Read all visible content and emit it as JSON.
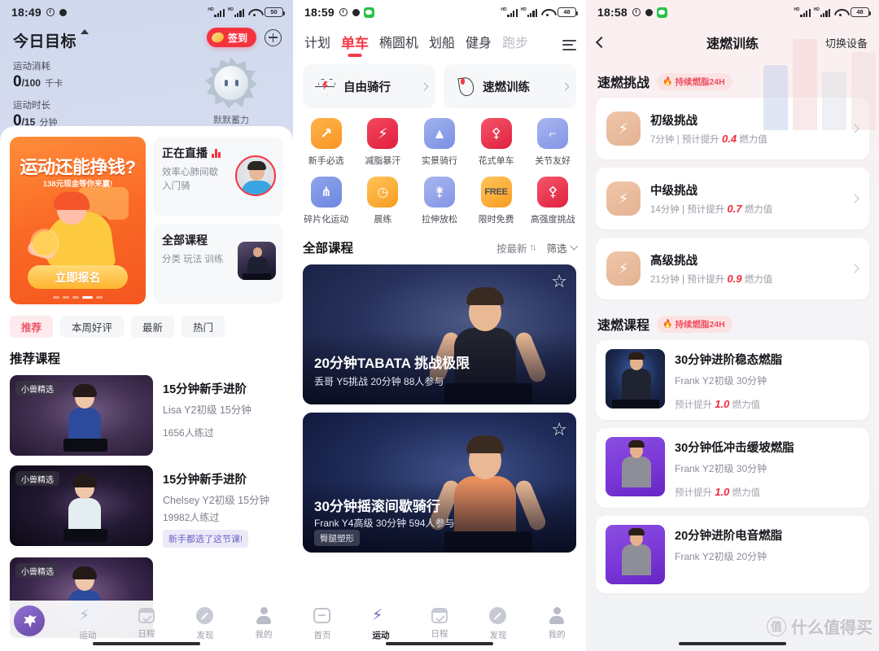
{
  "panel1": {
    "status": {
      "time": "18:49",
      "battery": "50",
      "icons": [
        "alarm-icon",
        "record-dot-icon",
        "signal-icon",
        "signal-icon",
        "wifi-icon",
        "battery-icon"
      ]
    },
    "header": {
      "title": "今日目标",
      "caret": "caret-up-icon",
      "stats": [
        {
          "label": "运动消耗",
          "value": "0",
          "unit": "/100",
          "suffix": "千卡"
        },
        {
          "label": "运动时长",
          "value": "0",
          "unit": "/15",
          "suffix": "分钟"
        }
      ],
      "signin_label": "签到",
      "add_label": "plus-icon",
      "mascot_label": "默默蓄力"
    },
    "promo": {
      "title": "运动还能挣钱?",
      "subtitle": "138元现金等你来赢!",
      "cta": "立即报名",
      "dots": 5,
      "active_dot": 3
    },
    "side_cards": [
      {
        "title": "正在直播",
        "live": true,
        "lines": "效率心肺间歇\n入门骑"
      },
      {
        "title": "全部课程",
        "live": false,
        "lines": "分类 玩法 训练"
      }
    ],
    "chips": [
      {
        "label": "推荐",
        "active": true
      },
      {
        "label": "本周好评",
        "active": false
      },
      {
        "label": "最新",
        "active": false
      },
      {
        "label": "热门",
        "active": false
      }
    ],
    "section_title": "推荐课程",
    "courses": [
      {
        "badge": "小兽精选",
        "title": "15分钟新手进阶",
        "sub": "Lisa Y2初级 15分钟",
        "count": "1656人练过",
        "tag": ""
      },
      {
        "badge": "小兽精选",
        "title": "15分钟新手进阶",
        "sub": "Chelsey Y2初级 15分钟",
        "count": "19982人练过",
        "tag": "新手都选了这节课!"
      },
      {
        "badge": "小兽精选",
        "title": "",
        "sub": "",
        "count": "",
        "tag": ""
      }
    ],
    "tabbar": [
      {
        "label": "",
        "icon": "unicorn-logo-icon",
        "active": true
      },
      {
        "label": "运动",
        "icon": "bolt-icon",
        "active": false
      },
      {
        "label": "日程",
        "icon": "calendar-check-icon",
        "active": false
      },
      {
        "label": "发现",
        "icon": "compass-icon",
        "active": false
      },
      {
        "label": "我的",
        "icon": "user-icon",
        "active": false
      }
    ]
  },
  "panel2": {
    "status": {
      "time": "18:59",
      "battery": "48",
      "icons": [
        "alarm-icon",
        "record-dot-icon",
        "wechat-icon",
        "signal-icon",
        "signal-icon",
        "wifi-icon",
        "battery-icon"
      ]
    },
    "tabs": [
      {
        "label": "计划",
        "active": false,
        "dim": false
      },
      {
        "label": "单车",
        "active": true,
        "dim": false
      },
      {
        "label": "椭圆机",
        "active": false,
        "dim": false
      },
      {
        "label": "划船",
        "active": false,
        "dim": false
      },
      {
        "label": "健身",
        "active": false,
        "dim": false
      },
      {
        "label": "跑步",
        "active": false,
        "dim": true
      }
    ],
    "menu_icon": "hamburger-icon",
    "modes": [
      {
        "label": "自由骑行",
        "icon": "heart-pulse-icon"
      },
      {
        "label": "速燃训练",
        "icon": "flame-icon"
      }
    ],
    "categories": [
      {
        "label": "新手必选",
        "icon": "arrow-up-trend-icon",
        "color": "c-orange",
        "glyph": "↗"
      },
      {
        "label": "减脂暴汗",
        "icon": "bolt-icon",
        "color": "c-red",
        "glyph": "⚡"
      },
      {
        "label": "实景骑行",
        "icon": "mountain-icon",
        "color": "c-blue",
        "glyph": "▲"
      },
      {
        "label": "花式单车",
        "icon": "cyclist-icon",
        "color": "c-pink",
        "glyph": "🚴"
      },
      {
        "label": "关节友好",
        "icon": "joint-icon",
        "color": "c-lav",
        "glyph": "ᒧ"
      },
      {
        "label": "碎片化运动",
        "icon": "stretch-person-icon",
        "color": "c-blue2",
        "glyph": "⋔"
      },
      {
        "label": "晨练",
        "icon": "clock-icon",
        "color": "c-amber",
        "glyph": "◷"
      },
      {
        "label": "拉伸放松",
        "icon": "stretch-icon",
        "color": "c-lav",
        "glyph": "ʎ"
      },
      {
        "label": "限时免费",
        "icon": "free-icon",
        "color": "c-amber",
        "glyph": "FREE"
      },
      {
        "label": "高强度挑战",
        "icon": "cyclist-intense-icon",
        "color": "c-pink",
        "glyph": "🚴"
      }
    ],
    "all_courses": {
      "title": "全部课程",
      "sort_label": "按最新",
      "sort_icon": "sort-arrows-icon",
      "filter_label": "筛选",
      "filter_icon": "chevron-down-icon"
    },
    "big_cards": [
      {
        "title": "20分钟TABATA 挑战极限",
        "sub": "丢哥  Y5挑战  20分钟  88人参与",
        "tag": "",
        "star": "star-outline-icon"
      },
      {
        "title": "30分钟摇滚间歇骑行",
        "sub": "Frank  Y4高级  30分钟  594人参与",
        "tag": "臀腿塑形",
        "star": "star-outline-icon"
      }
    ],
    "tabbar": [
      {
        "label": "首页",
        "icon": "home-icon",
        "active": false
      },
      {
        "label": "运动",
        "icon": "bolt-icon",
        "active": true
      },
      {
        "label": "日程",
        "icon": "calendar-check-icon",
        "active": false
      },
      {
        "label": "发现",
        "icon": "compass-icon",
        "active": false
      },
      {
        "label": "我的",
        "icon": "user-icon",
        "active": false
      }
    ]
  },
  "panel3": {
    "status": {
      "time": "18:58",
      "battery": "48",
      "icons": [
        "alarm-icon",
        "record-dot-icon",
        "wechat-icon",
        "signal-icon",
        "signal-icon",
        "wifi-icon",
        "battery-icon"
      ]
    },
    "nav": {
      "back": "back-chevron-icon",
      "title": "速燃训练",
      "right": "切换设备"
    },
    "challenge_section": {
      "title": "速燃挑战",
      "pill": "持续燃脂24H",
      "pill_icon": "flame-icon"
    },
    "challenges": [
      {
        "title": "初级挑战",
        "duration": "7分钟",
        "sep": "|",
        "prefix": "预计提升",
        "value": "0.4",
        "suffix": "燃力值",
        "icon": "bolt-icon"
      },
      {
        "title": "中级挑战",
        "duration": "14分钟",
        "sep": "|",
        "prefix": "预计提升",
        "value": "0.7",
        "suffix": "燃力值",
        "icon": "double-bolt-icon"
      },
      {
        "title": "高级挑战",
        "duration": "21分钟",
        "sep": "|",
        "prefix": "预计提升",
        "value": "0.9",
        "suffix": "燃力值",
        "icon": "triple-bolt-icon"
      }
    ],
    "course_section": {
      "title": "速燃课程",
      "pill": "持续燃脂24H",
      "pill_icon": "flame-icon"
    },
    "courses": [
      {
        "title": "30分钟进阶稳态燃脂",
        "sub": "Frank  Y2初级  30分钟",
        "prefix": "预计提升",
        "value": "1.0",
        "suffix": "燃力值",
        "thumb": "bt-blue"
      },
      {
        "title": "30分钟低冲击缓坡燃脂",
        "sub": "Frank  Y2初级  30分钟",
        "prefix": "预计提升",
        "value": "1.0",
        "suffix": "燃力值",
        "thumb": "bt-purple"
      },
      {
        "title": "20分钟进阶电音燃脂",
        "sub": "Frank  Y2初级  20分钟",
        "prefix": "预计提升",
        "value": "",
        "suffix": "",
        "thumb": "bt-purple"
      }
    ],
    "watermark": {
      "mark": "值",
      "text": "什么值得买"
    }
  }
}
